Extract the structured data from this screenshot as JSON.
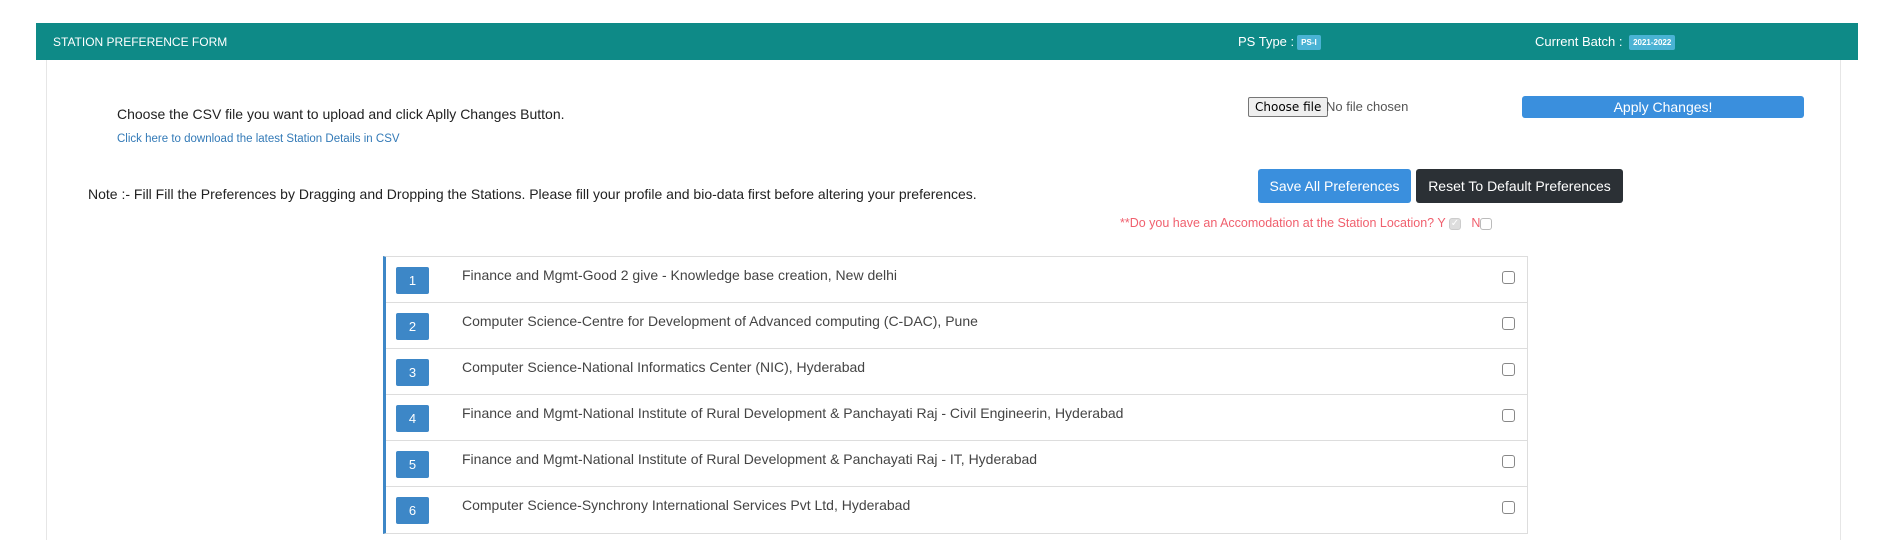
{
  "header": {
    "title": "STATION PREFERENCE FORM",
    "ps_type_label": "PS Type :",
    "ps_type": "PS-I",
    "batch_label": "Current Batch :",
    "batch": "2021-2022"
  },
  "upload": {
    "instruction": "Choose the CSV file you want to upload and click Aplly Changes Button.",
    "download_link": "Click here to download the latest Station Details in CSV",
    "choose_file": "Choose file",
    "no_file": "No file chosen",
    "apply": "Apply Changes!"
  },
  "note": "Note :- Fill Fill the Preferences by Dragging and Dropping the Stations. Please fill your profile and bio-data first before altering your preferences.",
  "buttons": {
    "save": "Save All Preferences",
    "reset": "Reset To Default Preferences"
  },
  "accommodation": {
    "question": "**Do you have an Accomodation at the Station Location? Y",
    "y_checked": true,
    "y_disabled": true,
    "no_label": "N",
    "n_checked": false
  },
  "stations": [
    {
      "num": "1",
      "name": "Finance and Mgmt-Good 2 give - Knowledge base creation, New delhi"
    },
    {
      "num": "2",
      "name": "Computer Science-Centre for Development of Advanced computing (C-DAC), Pune"
    },
    {
      "num": "3",
      "name": "Computer Science-National Informatics Center (NIC), Hyderabad"
    },
    {
      "num": "4",
      "name": "Finance and Mgmt-National Institute of Rural Development & Panchayati Raj - Civil Engineerin, Hyderabad"
    },
    {
      "num": "5",
      "name": "Finance and Mgmt-National Institute of Rural Development & Panchayati Raj - IT, Hyderabad"
    },
    {
      "num": "6",
      "name": "Computer Science-Synchrony International Services Pvt Ltd, Hyderabad"
    }
  ],
  "colors": {
    "header": "#0e8a87",
    "badge": "#4ab3d4",
    "primary": "#3a8fdd",
    "dark": "#2b3035",
    "warning_text": "#f0606e",
    "number_badge": "#3d87c7"
  }
}
